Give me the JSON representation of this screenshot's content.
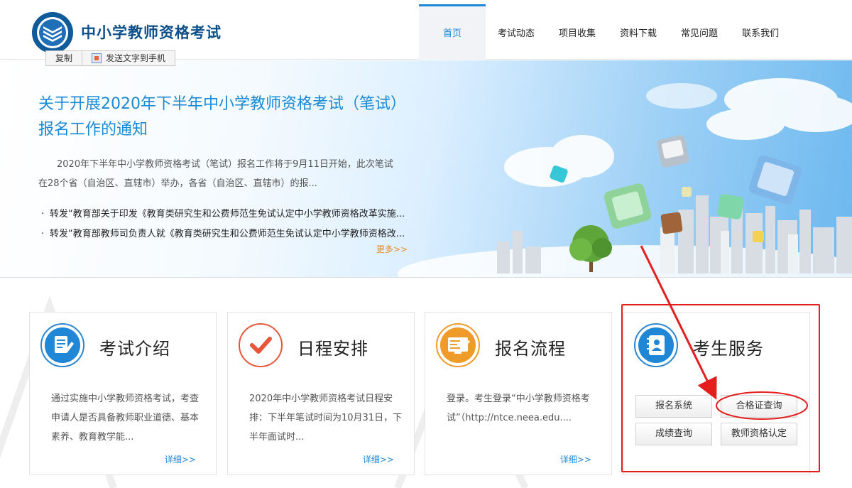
{
  "header": {
    "site_title": "中小学教师资格考试",
    "nav": [
      {
        "label": "首页",
        "active": true
      },
      {
        "label": "考试动态"
      },
      {
        "label": "项目收集"
      },
      {
        "label": "资料下载"
      },
      {
        "label": "常见问题"
      },
      {
        "label": "联系我们"
      }
    ]
  },
  "toolbar": {
    "copy_label": "复制",
    "send_label": "发送文字到手机"
  },
  "banner": {
    "title": "关于开展2020年下半年中小学教师资格考试（笔试）报名工作的通知",
    "description": "2020年下半年中小学教师资格考试（笔试）报名工作将于9月11日开始，此次笔试在28个省（自治区、直辖市）举办，各省（自治区、直辖市）的报...",
    "links": [
      "转发“教育部关于印发《教育类研究生和公费师范生免试认定中小学教师资格改革实施...",
      "转发“教育部教师司负责人就《教育类研究生和公费师范生免试认定中小学教师资格改..."
    ],
    "more": "更多>>"
  },
  "cards": [
    {
      "title": "考试介绍",
      "icon": "document-edit-icon",
      "text": "通过实施中小学教师资格考试，考查申请人是否具备教师职业道德、基本素养、教育教学能...",
      "more": "详细>>"
    },
    {
      "title": "日程安排",
      "icon": "checkmark-icon",
      "text": "2020年中小学教师资格考试日程安排：下半年笔试时间为10月31日，下半年面试时...",
      "more": "详细>>"
    },
    {
      "title": "报名流程",
      "icon": "form-screen-icon",
      "text": "登录。考生登录“中小学教师资格考试”（http://ntce.neea.edu....",
      "more": "详细>>"
    },
    {
      "title": "考生服务",
      "icon": "contact-book-icon",
      "buttons": [
        "报名系统",
        "合格证查询",
        "成绩查询",
        "教师资格认定"
      ]
    }
  ],
  "colors": {
    "brand_blue": "#1f87d6",
    "title_navy": "#0d4f8b",
    "accent_orange": "#e98a1f",
    "annotation_red": "#e41d1d"
  }
}
